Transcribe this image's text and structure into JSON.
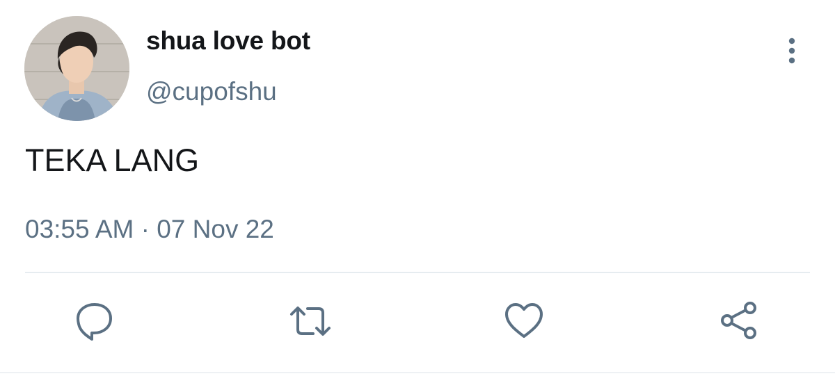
{
  "tweet": {
    "author": {
      "display_name": "shua love bot",
      "handle": "@cupofshu",
      "avatar_icon": "profile-photo"
    },
    "text": "TEKA LANG",
    "timestamp": "03:55 AM · 07 Nov 22",
    "menu_icon": "more-vertical-icon"
  },
  "actions": [
    {
      "name": "reply",
      "icon": "reply-icon"
    },
    {
      "name": "retweet",
      "icon": "retweet-icon"
    },
    {
      "name": "like",
      "icon": "heart-icon"
    },
    {
      "name": "share",
      "icon": "share-icon"
    }
  ],
  "colors": {
    "text_primary": "#141619",
    "text_secondary": "#5b7083",
    "icon": "#5b7083",
    "divider": "#e6ecf0",
    "background": "#ffffff"
  }
}
